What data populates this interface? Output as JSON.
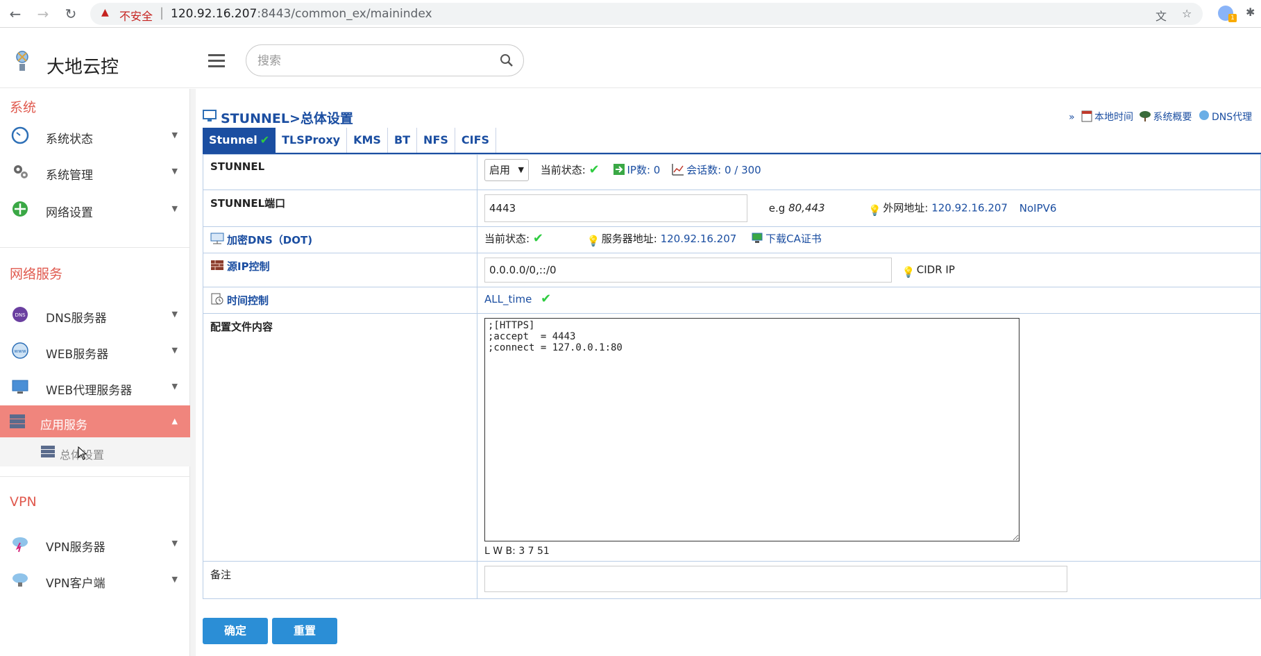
{
  "browser": {
    "insecure_label": "不安全",
    "url_host": "120.92.16.207",
    "url_path": ":8443/common_ex/mainindex",
    "ext_badge": "1"
  },
  "header": {
    "app_title": "大地云控",
    "search_placeholder": "搜索"
  },
  "sidebar": {
    "sections": [
      {
        "title": "系统"
      },
      {
        "title": "网络服务"
      },
      {
        "title": "VPN"
      }
    ],
    "items": [
      {
        "label": "系统状态",
        "icon": "dashboard-icon"
      },
      {
        "label": "系统管理",
        "icon": "gears-icon"
      },
      {
        "label": "网络设置",
        "icon": "network-icon"
      },
      {
        "label": "DNS服务器",
        "icon": "dns-icon"
      },
      {
        "label": "WEB服务器",
        "icon": "www-globe-icon"
      },
      {
        "label": "WEB代理服务器",
        "icon": "proxy-monitor-icon"
      },
      {
        "label": "应用服务",
        "icon": "server-stack-icon"
      },
      {
        "label": "VPN服务器",
        "icon": "cloud-bolt-icon"
      },
      {
        "label": "VPN客户端",
        "icon": "cloud-client-icon"
      }
    ],
    "sub_item": {
      "label": "总体设置"
    }
  },
  "page": {
    "title": "STUNNEL>总体设置",
    "quick_links": {
      "prefix": "»",
      "local_time": "本地时间",
      "sys_overview": "系统概要",
      "dns_proxy": "DNS代理"
    },
    "tabs": [
      "Stunnel",
      "TLSProxy",
      "KMS",
      "BT",
      "NFS",
      "CIFS"
    ],
    "active_tab_check": "✔"
  },
  "form": {
    "stunnel": {
      "label": "STUNNEL",
      "select_value": "启用",
      "status_label": "当前状态:",
      "ip_count": "IP数: 0",
      "sessions": "会话数: 0 / 300"
    },
    "port": {
      "label": "STUNNEL端口",
      "value": "4443",
      "example_prefix": "e.g",
      "example_value": "80,443",
      "external_label": "外网地址:",
      "external_ip": "120.92.16.207",
      "noipv6": "NoIPV6"
    },
    "dns": {
      "label": "加密DNS（DOT)",
      "status_label": "当前状态:",
      "server_label": "服务器地址:",
      "server_ip": "120.92.16.207",
      "download_ca": "下载CA证书"
    },
    "source_ip": {
      "label": "源IP控制",
      "value": "0.0.0.0/0,::/0",
      "hint": "CIDR IP"
    },
    "time_control": {
      "label": "时间控制",
      "value": "ALL_time"
    },
    "config": {
      "label": "配置文件内容",
      "content": ";[HTTPS]\n;accept  = 4443\n;connect = 127.0.0.1:80",
      "lwb": "L W B: 3 7 51"
    },
    "notes": {
      "label": "备注",
      "value": ""
    }
  },
  "buttons": {
    "confirm": "确定",
    "reset": "重置"
  },
  "colors": {
    "accent_blue": "#1b4ea1",
    "section_red": "#e05a4f",
    "active_item": "#f0857d",
    "button_blue": "#2b8ed6",
    "check_green": "#2ecc40"
  }
}
